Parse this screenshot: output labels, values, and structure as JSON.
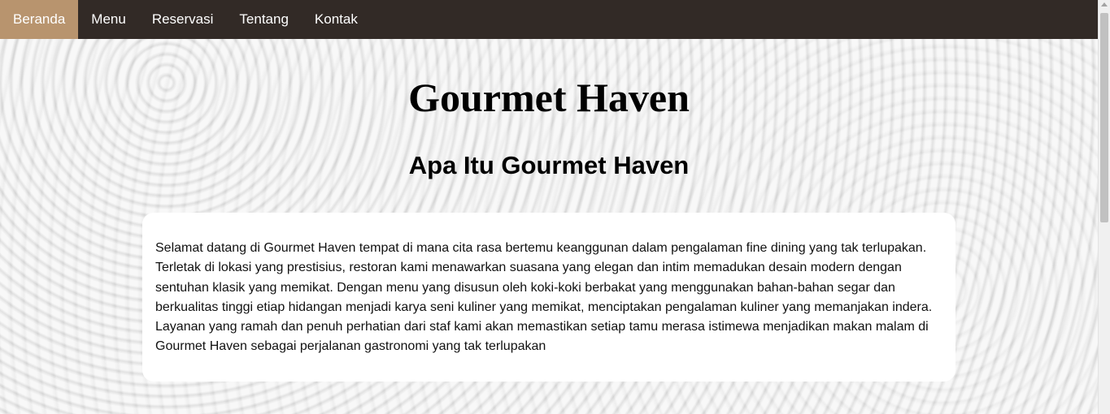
{
  "nav": {
    "items": [
      {
        "label": "Beranda"
      },
      {
        "label": "Menu"
      },
      {
        "label": "Reservasi"
      },
      {
        "label": "Tentang"
      },
      {
        "label": "Kontak"
      }
    ],
    "active_index": 0
  },
  "hero": {
    "title": "Gourmet Haven",
    "subtitle": "Apa Itu Gourmet Haven"
  },
  "about": {
    "paragraph": "Selamat datang di Gourmet Haven tempat di mana cita rasa bertemu keanggunan dalam pengalaman fine dining yang tak terlupakan. Terletak di lokasi yang prestisius, restoran kami menawarkan suasana yang elegan dan intim memadukan desain modern dengan sentuhan klasik yang memikat. Dengan menu yang disusun oleh koki-koki berbakat yang menggunakan bahan-bahan segar dan berkualitas tinggi etiap hidangan menjadi karya seni kuliner yang memikat, menciptakan pengalaman kuliner yang memanjakan indera. Layanan yang ramah dan penuh perhatian dari staf kami akan memastikan setiap tamu merasa istimewa menjadikan makan malam di Gourmet Haven sebagai perjalanan gastronomi yang tak terlupakan"
  },
  "colors": {
    "nav_background": "#322a26",
    "nav_active": "#b8946e",
    "card_background": "#ffffff"
  }
}
